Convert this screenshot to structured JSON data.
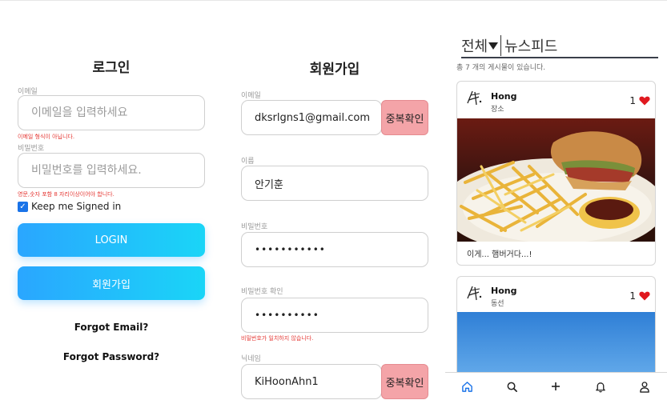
{
  "login": {
    "title": "로그인",
    "email_label": "이메일",
    "email_placeholder": "이메일을 입력하세요",
    "email_error": "이메일 형식이 아닙니다.",
    "password_label": "비밀번호",
    "password_placeholder": "비밀번호를 입력하세요.",
    "password_error": "영문,숫자 포함 8 자리이상이어야 합니다.",
    "keep_signed_in": "Keep me Signed in",
    "keep_checked": true,
    "login_button": "LOGIN",
    "signup_button": "회원가입",
    "forgot_email": "Forgot Email?",
    "forgot_password": "Forgot Password?"
  },
  "signup": {
    "title": "회원가입",
    "email_label": "이메일",
    "email_value": "dksrlgns1@gmail.com",
    "check_button": "중복확인",
    "name_label": "이름",
    "name_value": "안기훈",
    "password_label": "비밀번호",
    "password_value": "•••••••••••",
    "password_confirm_label": "비밀번호 확인",
    "password_confirm_value": "••••••••••",
    "password_error": "비밀번호가 일치하지 않습니다.",
    "nickname_label": "닉네임",
    "nickname_value": "KiHoonAhn1",
    "nickname_check_button": "중복확인"
  },
  "feed": {
    "filter": "전체",
    "title": "뉴스피드",
    "count_text": "총 7 개의 게시물이 있습니다.",
    "posts": [
      {
        "user": "Hong",
        "location": "장소",
        "likes": "1",
        "caption": "이게... 햄버거다...!"
      },
      {
        "user": "Hong",
        "location": "동선",
        "likes": "1",
        "caption": ""
      }
    ]
  },
  "nav": {
    "items": [
      "home-icon",
      "search-icon",
      "plus-icon",
      "bell-icon",
      "user-icon"
    ],
    "active_color": "#1a73e8"
  },
  "colors": {
    "button_gradient_start": "#2aa6ff",
    "button_gradient_end": "#1ad5f7",
    "check_button": "#f4a4a8",
    "error": "#e53935",
    "heart": "#e0191f"
  }
}
